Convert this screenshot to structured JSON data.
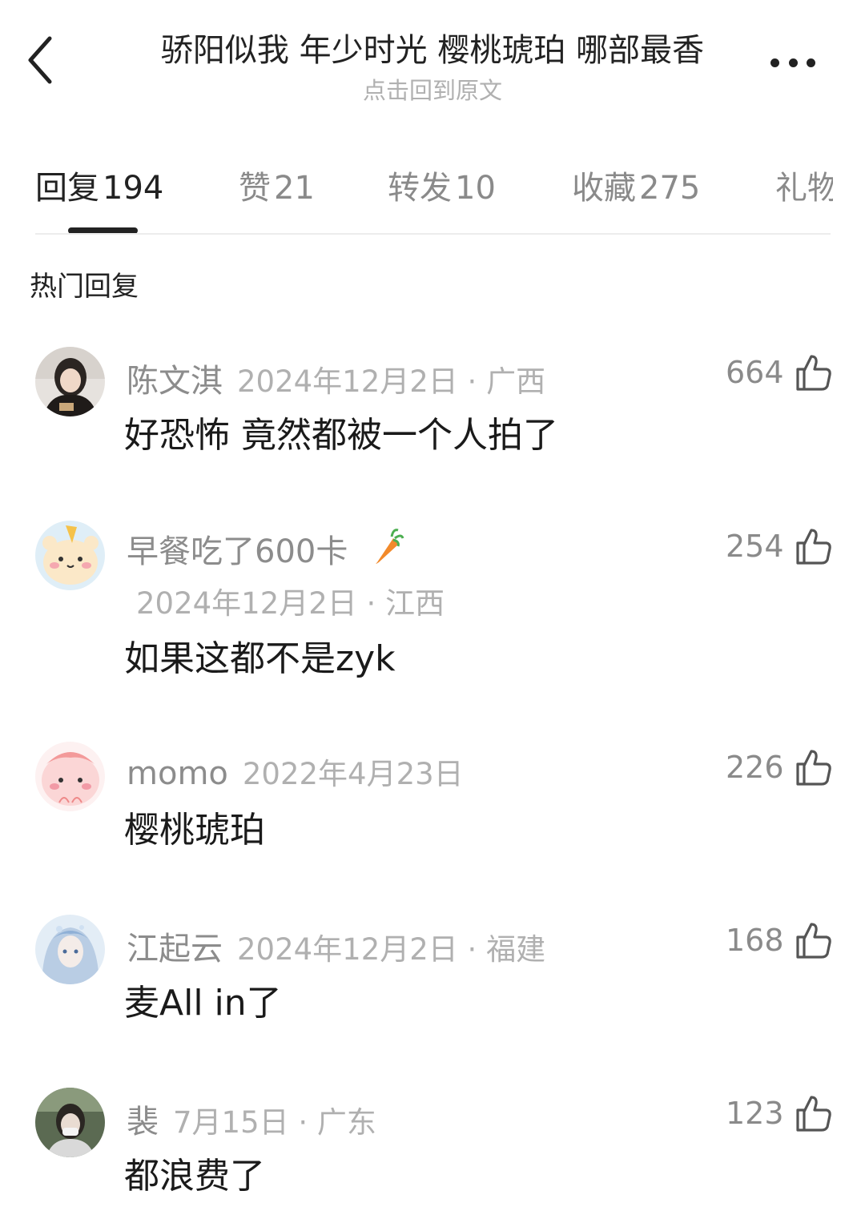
{
  "header": {
    "title": "骄阳似我 年少时光 樱桃琥珀 哪部最香",
    "subtitle": "点击回到原文"
  },
  "tabs": [
    {
      "label": "回复",
      "count": "194"
    },
    {
      "label": "赞",
      "count": "21"
    },
    {
      "label": "转发",
      "count": "10"
    },
    {
      "label": "收藏",
      "count": "275"
    },
    {
      "label": "礼物",
      "count": ""
    }
  ],
  "section_title": "热门回复",
  "comments": [
    {
      "name": "陈文淇",
      "meta": "2024年12月2日 · 广西",
      "text": "好恐怖 竟然都被一个人拍了",
      "likes": "664",
      "avatar": "photo-girl-dark"
    },
    {
      "name": "早餐吃了600卡",
      "meta": "2024年12月2日 · 江西",
      "text": "如果这都不是zyk",
      "likes": "254",
      "avatar": "cartoon-tiger",
      "badge": "carrot-icon"
    },
    {
      "name": "momo",
      "meta": "2022年4月23日",
      "text": "樱桃琥珀",
      "likes": "226",
      "avatar": "cartoon-pink"
    },
    {
      "name": "江起云",
      "meta": "2024年12月2日 · 福建",
      "text": "麦All in了",
      "likes": "168",
      "avatar": "anime-blue"
    },
    {
      "name": "裴",
      "meta": "7月15日 · 广东",
      "text": "都浪费了",
      "likes": "123",
      "avatar": "photo-girl-mask"
    }
  ],
  "colors": {
    "accent": "#222222",
    "muted": "#8a8a8a",
    "light": "#b0b0b0",
    "carrot": "#f28a2b"
  }
}
